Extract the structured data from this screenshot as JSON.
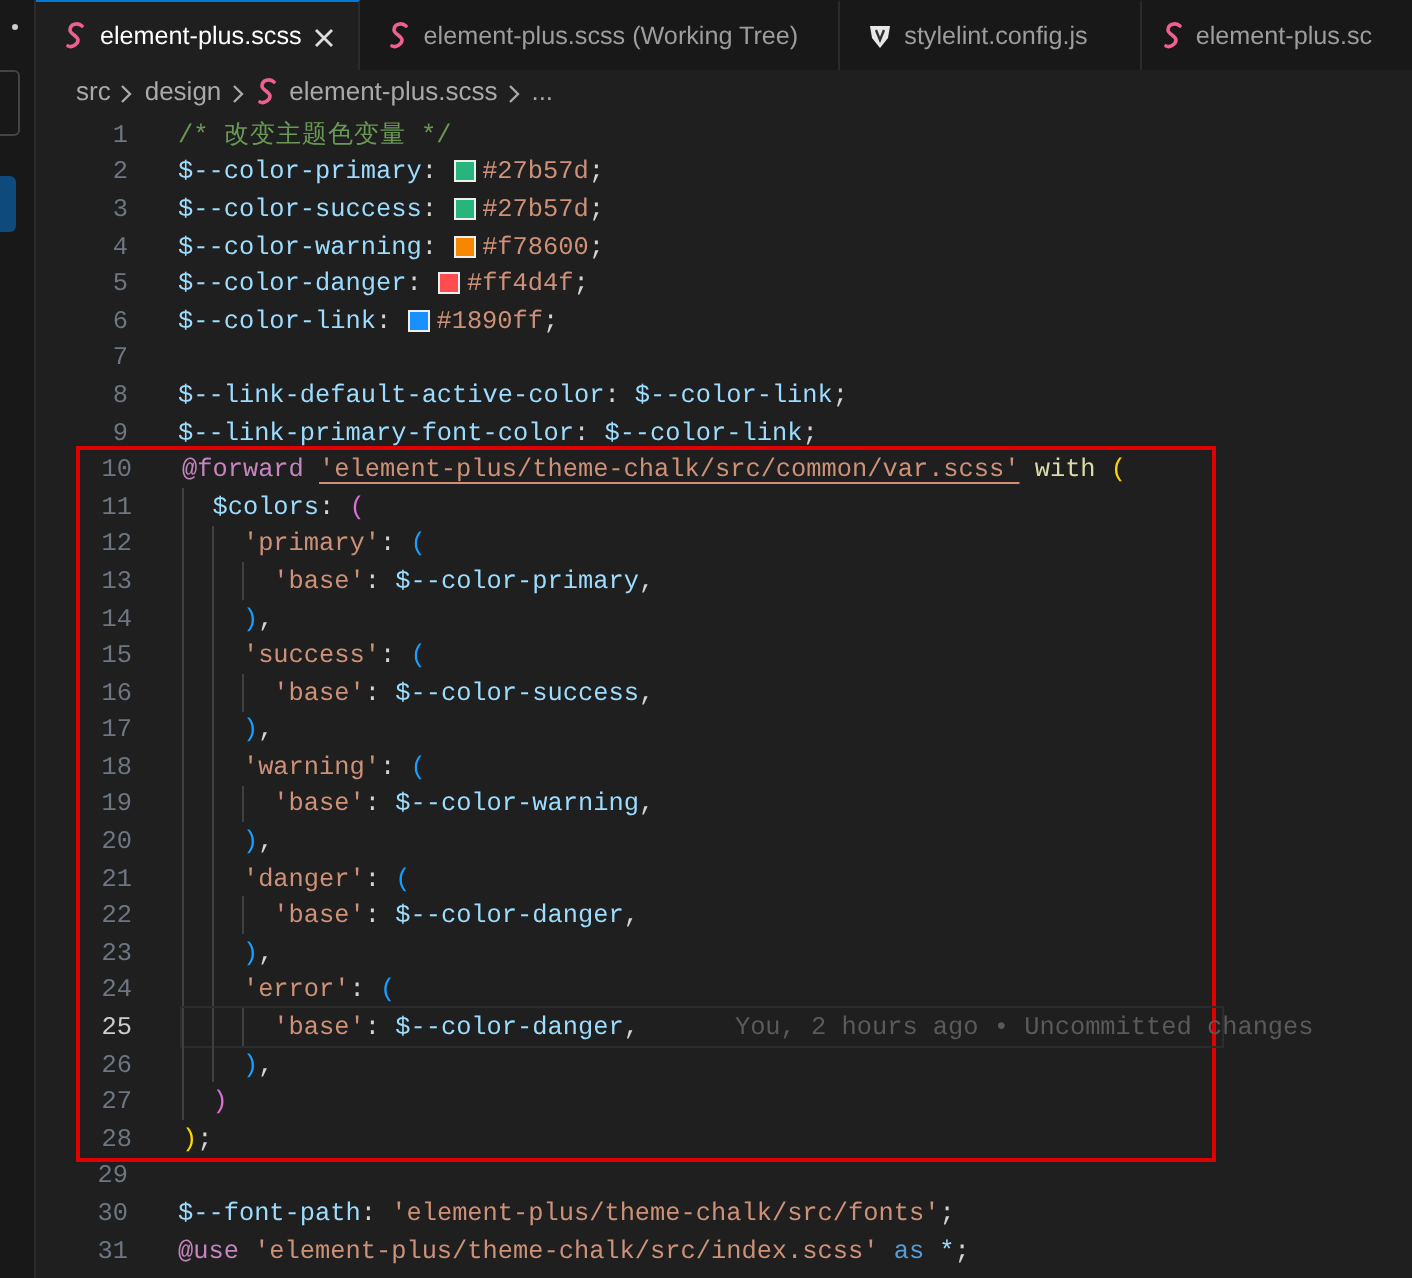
{
  "tabs": [
    {
      "label": "element-plus.scss",
      "kind": "scss",
      "selected": true,
      "closable": true
    },
    {
      "label": "element-plus.scss (Working Tree)",
      "kind": "scss",
      "selected": false
    },
    {
      "label": "stylelint.config.js",
      "kind": "stylelint",
      "selected": false
    },
    {
      "label": "element-plus.sc",
      "kind": "scss",
      "selected": false
    }
  ],
  "breadcrumb": [
    {
      "label": "src",
      "kind": "folder"
    },
    {
      "label": "design",
      "kind": "folder"
    },
    {
      "label": "element-plus.scss",
      "kind": "scss"
    },
    {
      "label": "...",
      "kind": "more"
    }
  ],
  "editor": {
    "lines": [
      {
        "number": "1",
        "boxed": false,
        "current": false,
        "tokens": [
          {
            "kind": "comment",
            "text": "/* 改变主题色变量 */"
          }
        ]
      },
      {
        "number": "2",
        "boxed": false,
        "current": false,
        "tokens": [
          {
            "kind": "var",
            "text": "$--color-primary"
          },
          {
            "kind": "punct",
            "text": ": "
          },
          {
            "kind": "swatch",
            "color": "#27b57d"
          },
          {
            "kind": "hex",
            "text": "#27b57d"
          },
          {
            "kind": "punct",
            "text": ";"
          }
        ]
      },
      {
        "number": "3",
        "boxed": false,
        "current": false,
        "tokens": [
          {
            "kind": "var",
            "text": "$--color-success"
          },
          {
            "kind": "punct",
            "text": ": "
          },
          {
            "kind": "swatch",
            "color": "#27b57d"
          },
          {
            "kind": "hex",
            "text": "#27b57d"
          },
          {
            "kind": "punct",
            "text": ";"
          }
        ]
      },
      {
        "number": "4",
        "boxed": false,
        "current": false,
        "tokens": [
          {
            "kind": "var",
            "text": "$--color-warning"
          },
          {
            "kind": "punct",
            "text": ": "
          },
          {
            "kind": "swatch",
            "color": "#f78600"
          },
          {
            "kind": "hex",
            "text": "#f78600"
          },
          {
            "kind": "punct",
            "text": ";"
          }
        ]
      },
      {
        "number": "5",
        "boxed": false,
        "current": false,
        "tokens": [
          {
            "kind": "var",
            "text": "$--color-danger"
          },
          {
            "kind": "punct",
            "text": ": "
          },
          {
            "kind": "swatch",
            "color": "#ff4d4f"
          },
          {
            "kind": "hex",
            "text": "#ff4d4f"
          },
          {
            "kind": "punct",
            "text": ";"
          }
        ]
      },
      {
        "number": "6",
        "boxed": false,
        "current": false,
        "tokens": [
          {
            "kind": "var",
            "text": "$--color-link"
          },
          {
            "kind": "punct",
            "text": ": "
          },
          {
            "kind": "swatch",
            "color": "#1890ff"
          },
          {
            "kind": "hex",
            "text": "#1890ff"
          },
          {
            "kind": "punct",
            "text": ";"
          }
        ]
      },
      {
        "number": "7",
        "boxed": false,
        "current": false
      },
      {
        "number": "8",
        "boxed": false,
        "current": false,
        "tokens": [
          {
            "kind": "var",
            "text": "$--link-default-active-color"
          },
          {
            "kind": "punct",
            "text": ": "
          },
          {
            "kind": "var",
            "text": "$--color-link"
          },
          {
            "kind": "punct",
            "text": ";"
          }
        ]
      },
      {
        "number": "9",
        "boxed": false,
        "current": false,
        "tokens": [
          {
            "kind": "var",
            "text": "$--link-primary-font-color"
          },
          {
            "kind": "punct",
            "text": ": "
          },
          {
            "kind": "var",
            "text": "$--color-link"
          },
          {
            "kind": "punct",
            "text": ";"
          }
        ]
      },
      {
        "number": "10",
        "boxed": true,
        "current": false,
        "tokens": [
          {
            "kind": "at",
            "text": "@forward"
          },
          {
            "kind": "link",
            "text": "'element-plus/theme-chalk/src/common/var.scss'"
          },
          {
            "kind": "kw",
            "text": "with"
          },
          {
            "kind": "b1",
            "text": "("
          }
        ]
      },
      {
        "number": "11",
        "boxed": true,
        "current": false,
        "tokens": [
          {
            "kind": "var",
            "text": "  $colors"
          },
          {
            "kind": "punct",
            "text": ": "
          },
          {
            "kind": "b2",
            "text": "("
          }
        ]
      },
      {
        "number": "12",
        "boxed": true,
        "current": false,
        "tokens": [
          {
            "kind": "str",
            "text": "    'primary'"
          },
          {
            "kind": "punct",
            "text": ": "
          },
          {
            "kind": "b3",
            "text": "("
          }
        ]
      },
      {
        "number": "13",
        "boxed": true,
        "current": false,
        "tokens": [
          {
            "kind": "str",
            "text": "      'base'"
          },
          {
            "kind": "punct",
            "text": ": "
          },
          {
            "kind": "var",
            "text": "$--color-primary"
          },
          {
            "kind": "punct",
            "text": ","
          }
        ]
      },
      {
        "number": "14",
        "boxed": true,
        "current": false,
        "tokens": [
          {
            "kind": "b3",
            "text": "    )"
          },
          {
            "kind": "punct",
            "text": ","
          }
        ]
      },
      {
        "number": "15",
        "boxed": true,
        "current": false,
        "tokens": [
          {
            "kind": "str",
            "text": "    'success'"
          },
          {
            "kind": "punct",
            "text": ": "
          },
          {
            "kind": "b3",
            "text": "("
          }
        ]
      },
      {
        "number": "16",
        "boxed": true,
        "current": false,
        "tokens": [
          {
            "kind": "str",
            "text": "      'base'"
          },
          {
            "kind": "punct",
            "text": ": "
          },
          {
            "kind": "var",
            "text": "$--color-success"
          },
          {
            "kind": "punct",
            "text": ","
          }
        ]
      },
      {
        "number": "17",
        "boxed": true,
        "current": false,
        "tokens": [
          {
            "kind": "b3",
            "text": "    )"
          },
          {
            "kind": "punct",
            "text": ","
          }
        ]
      },
      {
        "number": "18",
        "boxed": true,
        "current": false,
        "tokens": [
          {
            "kind": "str",
            "text": "    'warning'"
          },
          {
            "kind": "punct",
            "text": ": "
          },
          {
            "kind": "b3",
            "text": "("
          }
        ]
      },
      {
        "number": "19",
        "boxed": true,
        "current": false,
        "tokens": [
          {
            "kind": "str",
            "text": "      'base'"
          },
          {
            "kind": "punct",
            "text": ": "
          },
          {
            "kind": "var",
            "text": "$--color-warning"
          },
          {
            "kind": "punct",
            "text": ","
          }
        ]
      },
      {
        "number": "20",
        "boxed": true,
        "current": false,
        "tokens": [
          {
            "kind": "b3",
            "text": "    )"
          },
          {
            "kind": "punct",
            "text": ","
          }
        ]
      },
      {
        "number": "21",
        "boxed": true,
        "current": false,
        "tokens": [
          {
            "kind": "str",
            "text": "    'danger'"
          },
          {
            "kind": "punct",
            "text": ": "
          },
          {
            "kind": "b3",
            "text": "("
          }
        ]
      },
      {
        "number": "22",
        "boxed": true,
        "current": false,
        "tokens": [
          {
            "kind": "str",
            "text": "      'base'"
          },
          {
            "kind": "punct",
            "text": ": "
          },
          {
            "kind": "var",
            "text": "$--color-danger"
          },
          {
            "kind": "punct",
            "text": ","
          }
        ]
      },
      {
        "number": "23",
        "boxed": true,
        "current": false,
        "tokens": [
          {
            "kind": "b3",
            "text": "    )"
          },
          {
            "kind": "punct",
            "text": ","
          }
        ]
      },
      {
        "number": "24",
        "boxed": true,
        "current": false,
        "tokens": [
          {
            "kind": "str",
            "text": "    'error'"
          },
          {
            "kind": "punct",
            "text": ": "
          },
          {
            "kind": "b3",
            "text": "("
          }
        ]
      },
      {
        "number": "25",
        "boxed": true,
        "current": true,
        "tokens": [
          {
            "kind": "str",
            "text": "      'base'"
          },
          {
            "kind": "punct",
            "text": ": "
          },
          {
            "kind": "var",
            "text": "$--color-danger"
          },
          {
            "kind": "punct",
            "text": ","
          }
        ],
        "blame": "You, 2 hours ago • Uncommitted changes"
      },
      {
        "number": "26",
        "boxed": true,
        "current": false,
        "tokens": [
          {
            "kind": "b3",
            "text": "    )"
          },
          {
            "kind": "punct",
            "text": ","
          }
        ]
      },
      {
        "number": "27",
        "boxed": true,
        "current": false,
        "tokens": [
          {
            "kind": "b2",
            "text": "  )"
          }
        ]
      },
      {
        "number": "28",
        "boxed": true,
        "current": false,
        "tokens": [
          {
            "kind": "b1",
            "text": ")"
          },
          {
            "kind": "punct",
            "text": ";"
          }
        ]
      },
      {
        "number": "29",
        "boxed": false,
        "current": false
      },
      {
        "number": "30",
        "boxed": false,
        "current": false,
        "tokens": [
          {
            "kind": "var",
            "text": "$--font-path"
          },
          {
            "kind": "punct",
            "text": ": "
          },
          {
            "kind": "str",
            "text": "'element-plus/theme-chalk/src/fonts'"
          },
          {
            "kind": "punct",
            "text": ";"
          }
        ]
      },
      {
        "number": "31",
        "boxed": false,
        "current": false,
        "tokens": [
          {
            "kind": "at",
            "text": "@use"
          },
          {
            "kind": "str",
            "text": "'element-plus/theme-chalk/src/index.scss'"
          },
          {
            "kind": "kw2",
            "text": "as"
          },
          {
            "kind": "var",
            "text": "*"
          },
          {
            "kind": "punct",
            "text": ";"
          }
        ]
      }
    ]
  }
}
